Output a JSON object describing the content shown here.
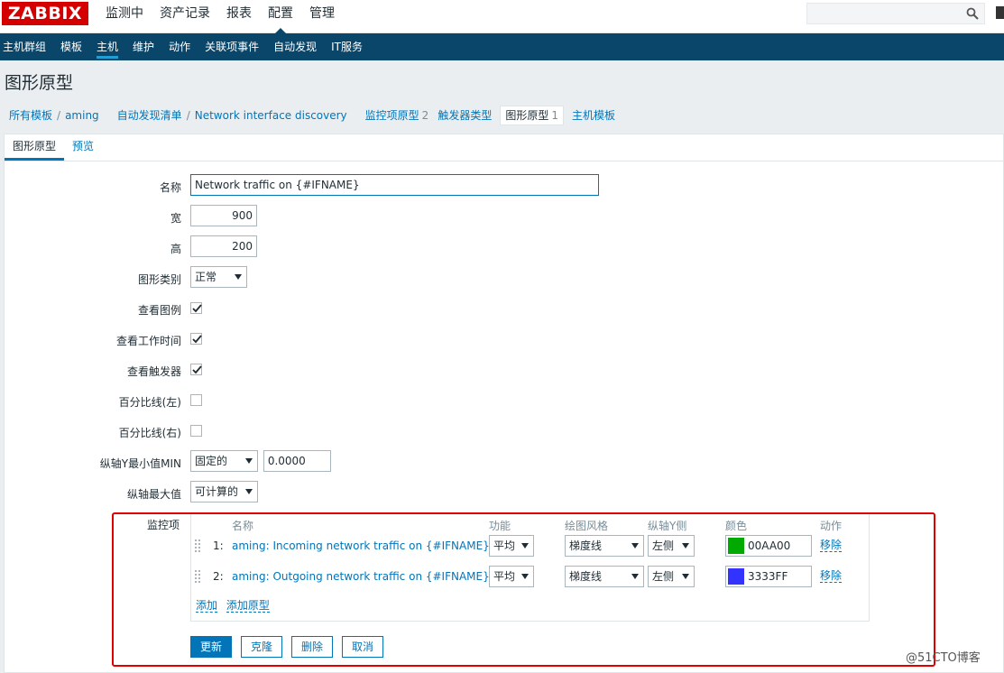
{
  "app": {
    "logo": "ZABBIX",
    "top_menu": [
      "监测中",
      "资产记录",
      "报表",
      "配置",
      "管理"
    ],
    "sub_menu": [
      "主机群组",
      "模板",
      "主机",
      "维护",
      "动作",
      "关联项事件",
      "自动发现",
      "IT服务"
    ],
    "search_placeholder": ""
  },
  "page": {
    "title": "图形原型",
    "breadcrumb": {
      "all_templates": "所有模板",
      "sep": "/",
      "host": "aming",
      "discovery_list": "自动发现清单",
      "rule": "Network interface discovery",
      "item_proto": "监控项原型",
      "item_proto_count": "2",
      "trigger_types": "触发器类型",
      "graph_proto": "图形原型",
      "graph_proto_count": "1",
      "host_proto": "主机模板"
    },
    "tabs": [
      "图形原型",
      "预览"
    ]
  },
  "form": {
    "name_label": "名称",
    "name_value": "Network traffic on {#IFNAME}",
    "width_label": "宽",
    "width_value": "900",
    "height_label": "高",
    "height_value": "200",
    "type_label": "图形类别",
    "type_value": "正常",
    "show_legend_label": "查看图例",
    "show_worktime_label": "查看工作时间",
    "show_triggers_label": "查看触发器",
    "pct_left_label": "百分比线(左)",
    "pct_right_label": "百分比线(右)",
    "ymin_label": "纵轴Y最小值MIN",
    "ymin_type": "固定的",
    "ymin_value": "0.0000",
    "ymax_label": "纵轴最大值",
    "ymax_type": "可计算的",
    "items_label": "监控项",
    "items_header": {
      "name": "名称",
      "func": "功能",
      "style": "绘图风格",
      "yaxis": "纵轴Y侧",
      "color": "颜色",
      "action": "动作"
    },
    "items": [
      {
        "idx": "1:",
        "name": "aming: Incoming network traffic on {#IFNAME}",
        "func": "平均",
        "style": "梯度线",
        "yaxis": "左侧",
        "color": "00AA00",
        "color_hex": "#00aa00",
        "remove": "移除"
      },
      {
        "idx": "2:",
        "name": "aming: Outgoing network traffic on {#IFNAME}",
        "func": "平均",
        "style": "梯度线",
        "yaxis": "左侧",
        "color": "3333FF",
        "color_hex": "#3333ff",
        "remove": "移除"
      }
    ],
    "add": "添加",
    "add_proto": "添加原型",
    "buttons": {
      "update": "更新",
      "clone": "克隆",
      "delete": "删除",
      "cancel": "取消"
    }
  },
  "watermark": "@51CTO博客"
}
